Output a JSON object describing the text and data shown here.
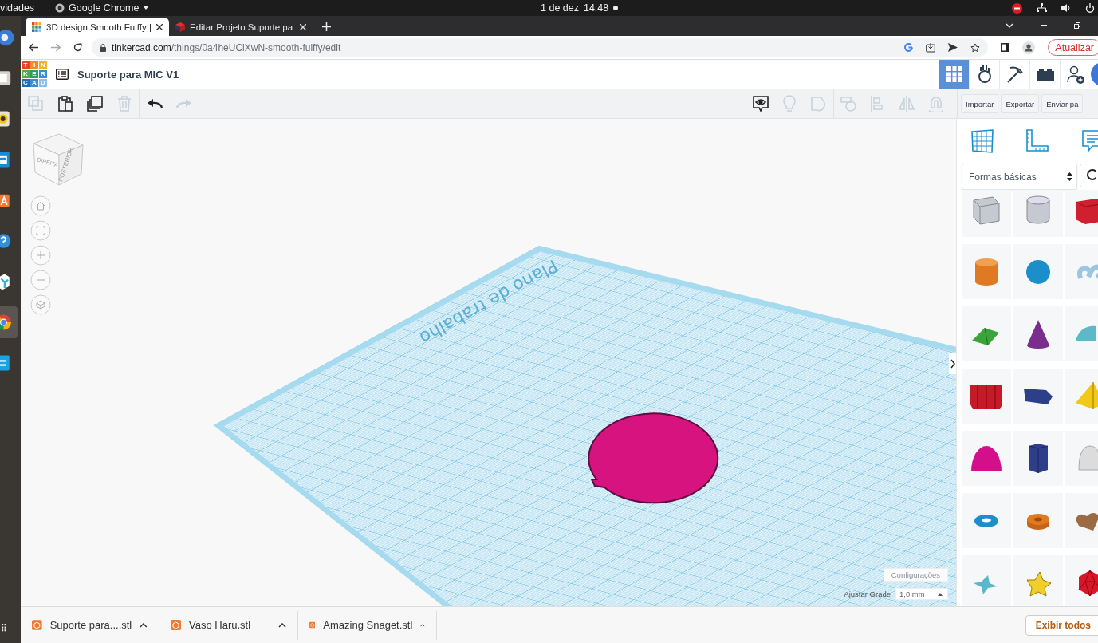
{
  "os_bar": {
    "activities": "vidades",
    "app": "Google Chrome",
    "date": "1 de dez",
    "time": "14:48"
  },
  "browser": {
    "tabs": [
      {
        "title": "3D design Smooth Fulffy |",
        "selected": true,
        "kind": "tiles"
      },
      {
        "title": "Editar Projeto Suporte pa",
        "selected": false,
        "kind": "cube"
      }
    ],
    "url_host": "tinkercad.com",
    "url_path": "/things/0a4heUClXwN-smooth-fulffy/edit",
    "update_button": "Atualizar"
  },
  "header": {
    "logo": [
      "T",
      "I",
      "N",
      "K",
      "E",
      "R",
      "C",
      "A",
      "D"
    ],
    "title": "Suporte para MIC V1",
    "nav": [
      {
        "kind": "grid",
        "selected": true
      },
      {
        "kind": "hand",
        "selected": false
      },
      {
        "kind": "pickaxe",
        "selected": false
      },
      {
        "kind": "brick",
        "selected": false
      },
      {
        "kind": "user-add",
        "selected": false
      }
    ]
  },
  "toolbar": {
    "edit_tools": [
      {
        "kind": "copy",
        "disabled": true
      },
      {
        "kind": "paste",
        "disabled": false
      },
      {
        "kind": "duplicate",
        "disabled": false
      },
      {
        "kind": "delete",
        "disabled": true
      },
      {
        "kind": "undo",
        "disabled": false
      },
      {
        "kind": "redo",
        "disabled": true
      }
    ],
    "view_tools": [
      {
        "kind": "notes",
        "disabled": false
      },
      {
        "kind": "bulb",
        "disabled": true
      },
      {
        "kind": "group",
        "disabled": true
      },
      {
        "kind": "ungroup",
        "disabled": true
      },
      {
        "kind": "align",
        "disabled": true
      },
      {
        "kind": "mirror",
        "disabled": true
      },
      {
        "kind": "magnet",
        "disabled": true
      }
    ],
    "buttons": [
      "Importar",
      "Exportar",
      "Enviar pa"
    ]
  },
  "view_cube": {
    "faces": [
      "DIREITA",
      "POSTERIOR"
    ]
  },
  "workplane": {
    "label": "Plano de trabalho"
  },
  "settings": {
    "button": "Configurações",
    "grid_label": "Ajustar Grade",
    "grid_value": "1,0 mm"
  },
  "panel": {
    "tabs": [
      {
        "kind": "workplane"
      },
      {
        "kind": "ruler"
      },
      {
        "kind": "notes"
      }
    ],
    "category": "Formas básicas",
    "shapes": [
      {
        "kind": "box-hole"
      },
      {
        "kind": "cylinder-hole"
      },
      {
        "kind": "box"
      },
      {
        "kind": "cylinder"
      },
      {
        "kind": "sphere"
      },
      {
        "kind": "scribble"
      },
      {
        "kind": "roof"
      },
      {
        "kind": "cone"
      },
      {
        "kind": "round-roof"
      },
      {
        "kind": "text"
      },
      {
        "kind": "polygon"
      },
      {
        "kind": "pyramid"
      },
      {
        "kind": "half-sphere"
      },
      {
        "kind": "prism"
      },
      {
        "kind": "paraboloid"
      },
      {
        "kind": "torus"
      },
      {
        "kind": "tube"
      },
      {
        "kind": "heart"
      },
      {
        "kind": "star"
      },
      {
        "kind": "star-prism"
      },
      {
        "kind": "icosahedron"
      }
    ]
  },
  "downloads": {
    "files": [
      "Suporte para....stl",
      "Vaso Haru.stl",
      "Amazing Snaget.stl"
    ],
    "show_all": "Exibir todos"
  }
}
